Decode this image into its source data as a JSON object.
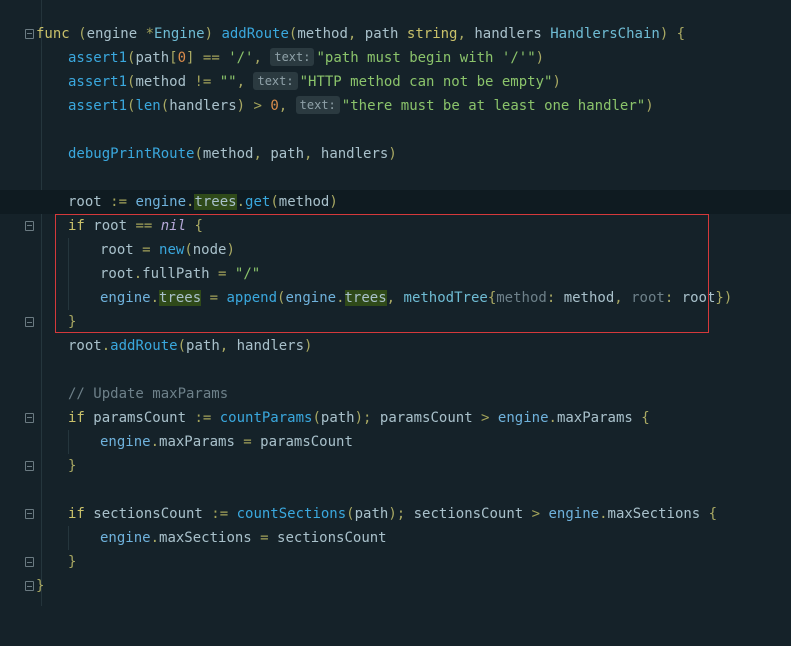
{
  "code": {
    "line1": {
      "func": "func",
      "open_paren": " (",
      "engine": "engine",
      "star": " *",
      "Engine": "Engine",
      "rp": ") ",
      "addRoute": "addRoute",
      "lp2": "(",
      "method": "method",
      "comma1": ", ",
      "path": "path",
      "string": " string",
      "comma2": ", ",
      "handlers": "handlers",
      "HandlersChain": " HandlersChain",
      "close": ") {"
    },
    "line2": {
      "assert1": "assert1",
      "p1": "(",
      "path": "path",
      "br1": "[",
      "zero": "0",
      "br2": "]",
      "eq": " == ",
      "slash": "'/'",
      "comma": ", ",
      "hint": "text:",
      "msg": "\"path must begin with '/'\"",
      "close": ")"
    },
    "line3": {
      "assert1": "assert1",
      "p1": "(",
      "method": "method",
      "ne": " != ",
      "empty": "\"\"",
      "comma": ", ",
      "hint": "text:",
      "msg": "\"HTTP method can not be empty\"",
      "close": ")"
    },
    "line4": {
      "assert1": "assert1",
      "p1": "(",
      "len": "len",
      "p2": "(",
      "handlers": "handlers",
      "p3": ")",
      "gt": " > ",
      "zero": "0",
      "comma": ", ",
      "hint": "text:",
      "msg": "\"there must be at least one handler\"",
      "close": ")"
    },
    "line6": {
      "fn": "debugPrintRoute",
      "p1": "(",
      "method": "method",
      "c1": ", ",
      "path": "path",
      "c2": ", ",
      "handlers": "handlers",
      "close": ")"
    },
    "line8": {
      "root": "root",
      "assign": " := ",
      "engine": "engine",
      "dot1": ".",
      "trees": "trees",
      "dot2": ".",
      "get": "get",
      "p1": "(",
      "method": "method",
      "close": ")"
    },
    "line9": {
      "if": "if",
      "root": " root",
      "eq": " == ",
      "nil": "nil",
      "brace": " {"
    },
    "line10": {
      "root": "root",
      "eq": " = ",
      "new": "new",
      "p1": "(",
      "node": "node",
      "close": ")"
    },
    "line11": {
      "root": "root",
      "dot": ".",
      "fullPath": "fullPath",
      "eq": " = ",
      "str": "\"/\""
    },
    "line12": {
      "engine": "engine",
      "dot1": ".",
      "trees": "trees",
      "eq": " = ",
      "append": "append",
      "p1": "(",
      "engine2": "engine",
      "dot2": ".",
      "trees2": "trees",
      "comma": ", ",
      "methodTree": "methodTree",
      "lb": "{",
      "f1": "method",
      "colon1": ": ",
      "v1": "method",
      "c2": ", ",
      "f2": "root",
      "colon2": ": ",
      "v2": "root",
      "rb": "})"
    },
    "line13": {
      "brace": "}"
    },
    "line14": {
      "root": "root",
      "dot": ".",
      "addRoute": "addRoute",
      "p1": "(",
      "path": "path",
      "c": ", ",
      "handlers": "handlers",
      "close": ")"
    },
    "line16": {
      "comment": "// Update maxParams"
    },
    "line17": {
      "if": "if",
      "pc": " paramsCount",
      "assign": " := ",
      "fn": "countParams",
      "p1": "(",
      "path": "path",
      "p2": ")",
      "semi": "; ",
      "pc2": "paramsCount",
      "gt": " > ",
      "engine": "engine",
      "dot": ".",
      "mp": "maxParams",
      "brace": " {"
    },
    "line18": {
      "engine": "engine",
      "dot": ".",
      "mp": "maxParams",
      "eq": " = ",
      "pc": "paramsCount"
    },
    "line19": {
      "brace": "}"
    },
    "line21": {
      "if": "if",
      "sc": " sectionsCount",
      "assign": " := ",
      "fn": "countSections",
      "p1": "(",
      "path": "path",
      "p2": ")",
      "semi": "; ",
      "sc2": "sectionsCount",
      "gt": " > ",
      "engine": "engine",
      "dot": ".",
      "ms": "maxSections",
      "brace": " {"
    },
    "line22": {
      "engine": "engine",
      "dot": ".",
      "ms": "maxSections",
      "eq": " = ",
      "sc": "sectionsCount"
    },
    "line23": {
      "brace": "}"
    },
    "line24": {
      "brace": "}"
    }
  }
}
